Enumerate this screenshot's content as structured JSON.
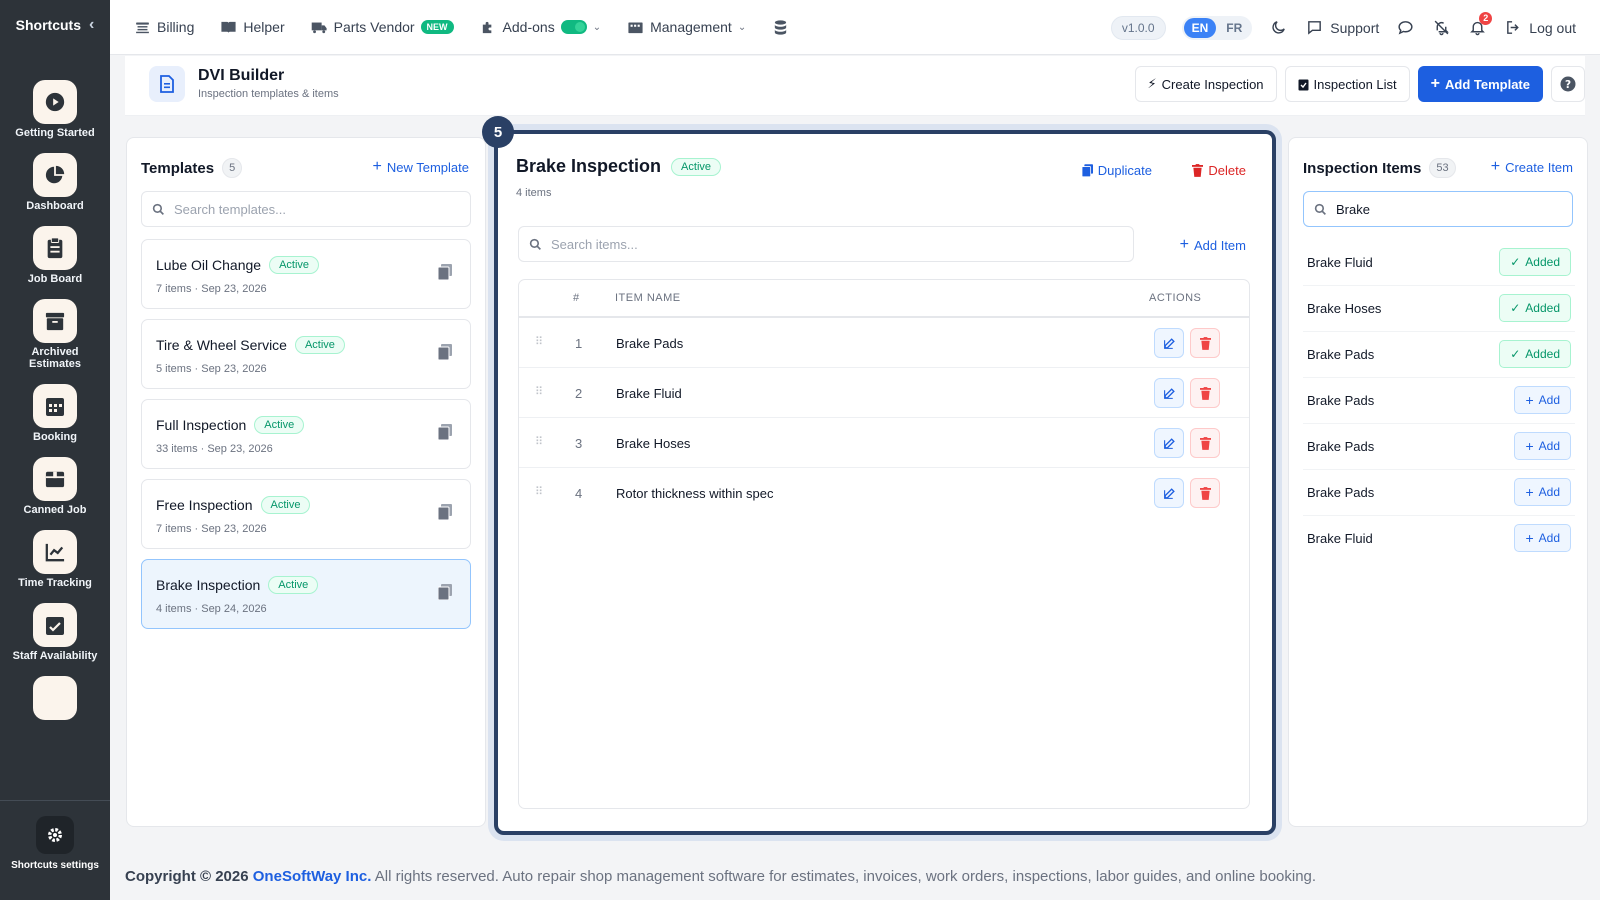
{
  "sidebar": {
    "title": "Shortcuts",
    "items": [
      {
        "label": "Getting Started",
        "icon": "play-icon"
      },
      {
        "label": "Dashboard",
        "icon": "pie-chart-icon"
      },
      {
        "label": "Job Board",
        "icon": "clipboard-icon"
      },
      {
        "label": "Archived Estimates",
        "icon": "archive-icon"
      },
      {
        "label": "Booking",
        "icon": "calendar-icon"
      },
      {
        "label": "Canned Job",
        "icon": "box-icon"
      },
      {
        "label": "Time Tracking",
        "icon": "chart-line-icon"
      },
      {
        "label": "Staff Availability",
        "icon": "calendar-check-icon"
      }
    ],
    "settings_label": "Shortcuts settings"
  },
  "topnav": {
    "billing": "Billing",
    "helper": "Helper",
    "parts_vendor": "Parts Vendor",
    "new_badge": "NEW",
    "addons": "Add-ons",
    "management": "Management",
    "version": "v1.0.0",
    "lang_en": "EN",
    "lang_fr": "FR",
    "support": "Support",
    "notif_count": "2",
    "logout": "Log out"
  },
  "page": {
    "title": "DVI Builder",
    "subtitle": "Inspection templates & items",
    "create_inspection": "Create Inspection",
    "inspection_list": "Inspection List",
    "add_template": "Add Template"
  },
  "templates": {
    "title": "Templates",
    "count": "5",
    "new_label": "New Template",
    "search_placeholder": "Search templates...",
    "items": [
      {
        "name": "Lube Oil Change",
        "status": "Active",
        "meta": "7 items · Sep 23, 2026"
      },
      {
        "name": "Tire & Wheel Service",
        "status": "Active",
        "meta": "5 items · Sep 23, 2026"
      },
      {
        "name": "Full Inspection",
        "status": "Active",
        "meta": "33 items · Sep 23, 2026"
      },
      {
        "name": "Free Inspection",
        "status": "Active",
        "meta": "7 items · Sep 23, 2026"
      },
      {
        "name": "Brake Inspection",
        "status": "Active",
        "meta": "4 items · Sep 24, 2026"
      }
    ]
  },
  "step": "5",
  "detail": {
    "title": "Brake Inspection",
    "status": "Active",
    "count_label": "4 items",
    "duplicate": "Duplicate",
    "delete": "Delete",
    "search_placeholder": "Search items...",
    "add_item": "Add Item",
    "col_num": "#",
    "col_name": "ITEM NAME",
    "col_actions": "ACTIONS",
    "rows": [
      {
        "num": "1",
        "name": "Brake Pads"
      },
      {
        "num": "2",
        "name": "Brake Fluid"
      },
      {
        "num": "3",
        "name": "Brake Hoses"
      },
      {
        "num": "4",
        "name": "Rotor thickness within spec"
      }
    ]
  },
  "items_panel": {
    "title": "Inspection Items",
    "count": "53",
    "create_label": "Create Item",
    "search_value": "Brake",
    "added_label": "Added",
    "add_label": "Add",
    "rows": [
      {
        "name": "Brake Fluid",
        "added": true
      },
      {
        "name": "Brake Hoses",
        "added": true
      },
      {
        "name": "Brake Pads",
        "added": true
      },
      {
        "name": "Brake Pads",
        "added": false
      },
      {
        "name": "Brake Pads",
        "added": false
      },
      {
        "name": "Brake Pads",
        "added": false
      },
      {
        "name": "Brake Fluid",
        "added": false
      }
    ]
  },
  "footer": {
    "prefix": "Copyright © 2026",
    "brand": "OneSoftWay Inc.",
    "rest": "All rights reserved. Auto repair shop management software for estimates, invoices, work orders, inspections, labor guides, and online booking."
  },
  "colors": {
    "primary": "#1d5fe0",
    "success": "#059669",
    "danger": "#dc2626",
    "sidebar": "#2d3339",
    "focus": "#2a4065"
  }
}
